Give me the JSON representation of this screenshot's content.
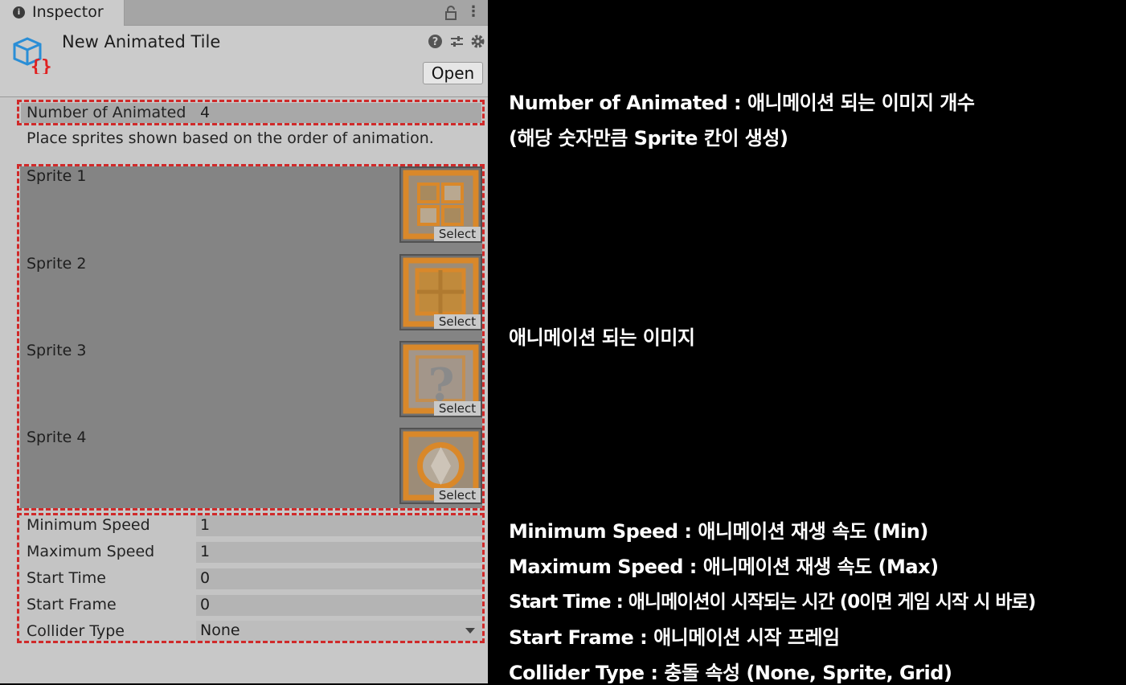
{
  "inspector": {
    "tab_title": "Inspector",
    "asset_name": "New Animated Tile",
    "open_label": "Open",
    "number_label": "Number of Animated",
    "number_value": "4",
    "help_text": "Place sprites shown based on the order of animation.",
    "sprites": [
      {
        "label": "Sprite 1",
        "select": "Select"
      },
      {
        "label": "Sprite 2",
        "select": "Select"
      },
      {
        "label": "Sprite 3",
        "select": "Select"
      },
      {
        "label": "Sprite 4",
        "select": "Select"
      }
    ],
    "properties": [
      {
        "label": "Minimum Speed",
        "value": "1"
      },
      {
        "label": "Maximum Speed",
        "value": "1"
      },
      {
        "label": "Start Time",
        "value": "0"
      },
      {
        "label": "Start Frame",
        "value": "0"
      },
      {
        "label": "Collider Type",
        "value": "None"
      }
    ]
  },
  "notes": {
    "number_line1": "Number of Animated : 애니메이션 되는 이미지 개수",
    "number_line2": "(해당 숫자만큼 Sprite 칸이 생성)",
    "sprites": "애니메이션 되는 이미지",
    "min_speed": "Minimum Speed : 애니메이션 재생 속도 (Min)",
    "max_speed": "Maximum Speed : 애니메이션 재생 속도 (Max)",
    "start_time": "Start Time : 애니메이션이 시작되는 시간 (0이면 게임 시작 시 바로)",
    "start_frame": "Start Frame : 애니메이션 시작 프레임",
    "collider_type": "Collider Type : 충돌 속성 (None, Sprite, Grid)"
  },
  "colors": {
    "highlight_dash": "#d02a2a",
    "tile_orange": "#d9882a",
    "asset_icon_blue": "#2a8ed6",
    "asset_icon_red": "#e02020"
  },
  "icons": [
    "info-icon",
    "lock-icon",
    "kebab-menu-icon",
    "animated-tile-asset-icon",
    "help-icon",
    "preset-icon",
    "gear-icon",
    "dropdown-arrow-icon"
  ]
}
